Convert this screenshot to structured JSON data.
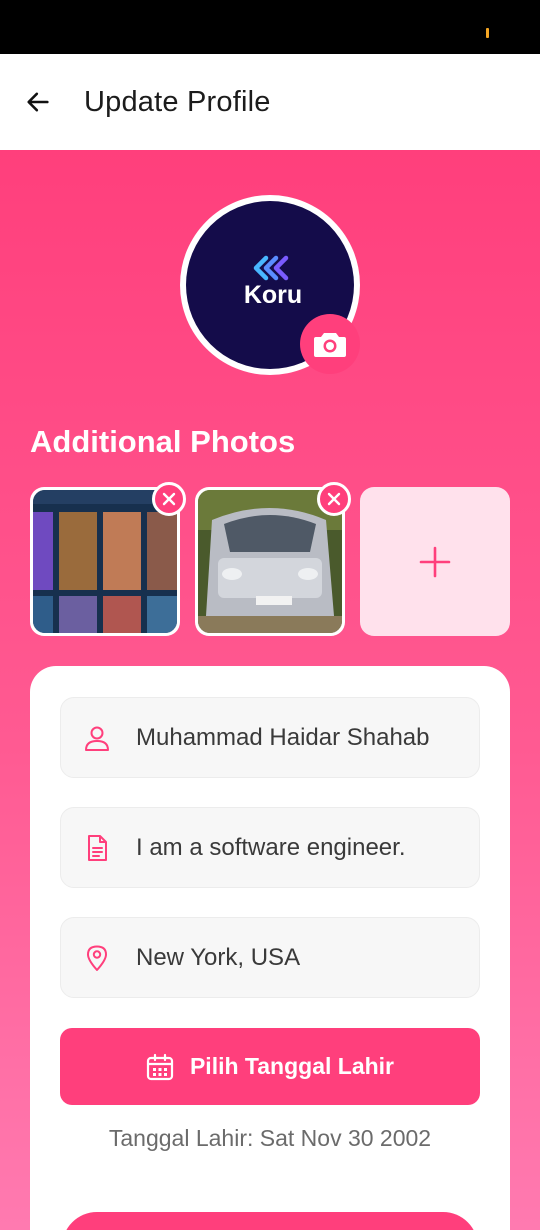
{
  "app_bar": {
    "title": "Update Profile"
  },
  "profile": {
    "logo_text": "Koru"
  },
  "additional_photos": {
    "title": "Additional Photos"
  },
  "form": {
    "name": "Muhammad Haidar Shahab",
    "bio": "I am a software engineer.",
    "location": "New York, USA",
    "date_button_label": "Pilih Tanggal Lahir",
    "date_info": "Tanggal Lahir: Sat Nov 30 2002"
  },
  "colors": {
    "accent": "#ff3f7c",
    "add_tile_bg": "#ffe1ec",
    "avatar_bg": "#140c4a"
  },
  "icons": [
    "back-arrow-icon",
    "camera-icon",
    "close-icon",
    "plus-icon",
    "person-icon",
    "document-icon",
    "location-pin-icon",
    "calendar-icon"
  ]
}
